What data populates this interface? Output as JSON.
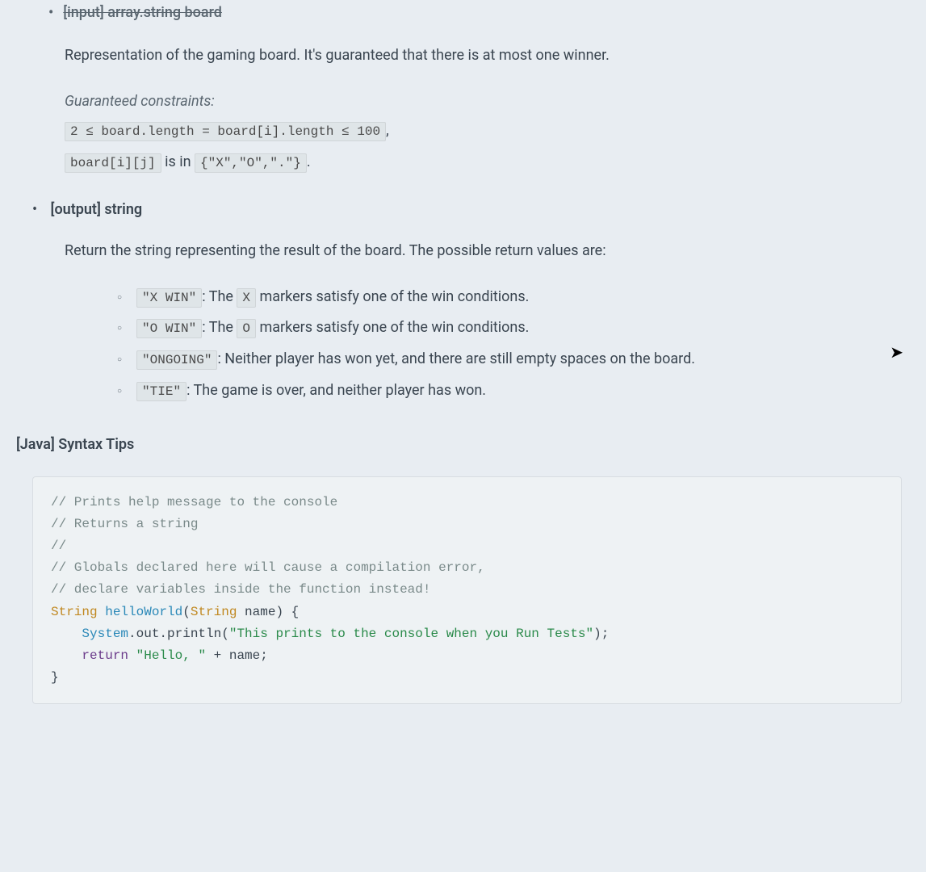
{
  "header": {
    "strikethrough_text": "[input] array.string board"
  },
  "input": {
    "description": "Representation of the gaming board. It's guaranteed that there is at most one winner.",
    "constraints_label": "Guaranteed constraints:",
    "constraint1_code": "2 ≤ board.length = board[i].length ≤ 100",
    "constraint1_suffix": ",",
    "constraint2_code1": "board[i][j]",
    "constraint2_mid": " is in ",
    "constraint2_code2": "{\"X\",\"O\",\".\"}",
    "constraint2_suffix": "."
  },
  "output": {
    "heading": "[output] string",
    "description": "Return the string representing the result of the board. The possible return values are:",
    "items": [
      {
        "code": "\"X WIN\"",
        "sep": ": The ",
        "inline": "X",
        "rest": " markers satisfy one of the win conditions."
      },
      {
        "code": "\"O WIN\"",
        "sep": ": The ",
        "inline": "O",
        "rest": " markers satisfy one of the win conditions."
      },
      {
        "code": "\"ONGOING\"",
        "sep": ": Neither player has won yet, and there are still empty spaces on the board.",
        "inline": "",
        "rest": ""
      },
      {
        "code": "\"TIE\"",
        "sep": ": The game is over, and neither player has won.",
        "inline": "",
        "rest": ""
      }
    ]
  },
  "syntax_tips": {
    "heading": "[Java] Syntax Tips",
    "code": {
      "l1": "// Prints help message to the console",
      "l2": "// Returns a string",
      "l3": "//",
      "l4": "// Globals declared here will cause a compilation error,",
      "l5": "// declare variables inside the function instead!",
      "l6_type": "String",
      "l6_method": " helloWorld",
      "l6_rest1": "(",
      "l6_param_type": "String",
      "l6_rest2": " name) {",
      "l7_indent": "    ",
      "l7_obj": "System",
      "l7_mid": ".out.println(",
      "l7_str": "\"This prints to the console when you Run Tests\"",
      "l7_end": ");",
      "l8_indent": "    ",
      "l8_kw": "return",
      "l8_sp": " ",
      "l8_str": "\"Hello, \"",
      "l8_rest": " + name;",
      "l9": "}"
    }
  }
}
